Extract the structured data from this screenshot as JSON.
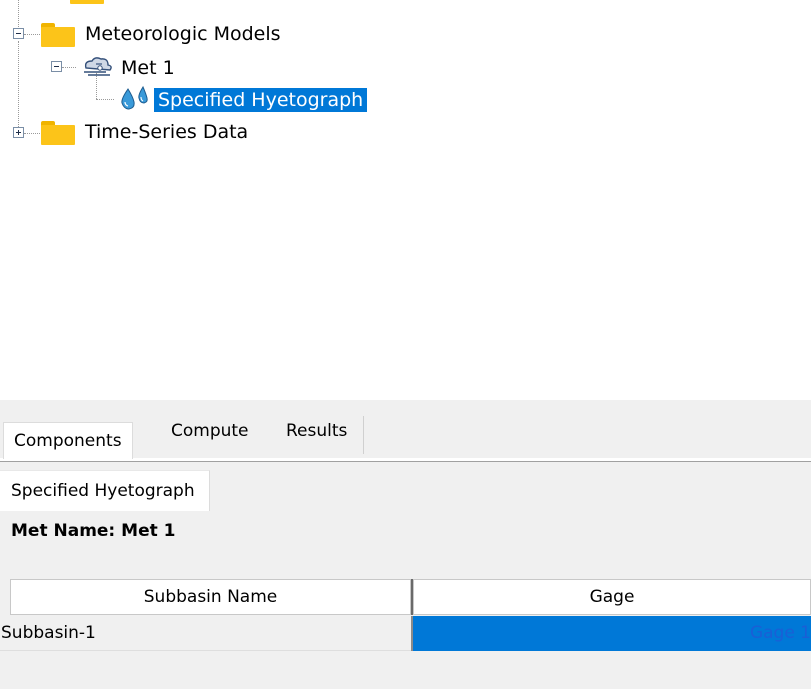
{
  "tree": {
    "items": [
      {
        "label": "Meteorologic Models",
        "icon": "folder-icon",
        "expander": "minus"
      },
      {
        "label": "Met 1",
        "icon": "met-model-icon",
        "expander": "minus"
      },
      {
        "label": "Specified Hyetograph",
        "icon": "precipitation-drops-icon",
        "selected": true
      },
      {
        "label": "Time-Series Data",
        "icon": "folder-icon",
        "expander": "plus"
      }
    ]
  },
  "tabs": {
    "items": [
      {
        "label": "Components",
        "active": true
      },
      {
        "label": "Compute",
        "active": false
      },
      {
        "label": "Results",
        "active": false
      }
    ]
  },
  "editor": {
    "subtab_label": "Specified Hyetograph",
    "met_name_label": "Met Name:",
    "met_name_value": "Met 1",
    "table": {
      "columns": [
        "Subbasin Name",
        "Gage"
      ],
      "rows": [
        [
          "Subbasin-1",
          "Gage 1"
        ]
      ]
    }
  },
  "colors": {
    "selection": "#0078d7",
    "folder": "#fcc419",
    "gage_text": "#1a5fd6",
    "panel_bg": "#f0f0f0"
  }
}
